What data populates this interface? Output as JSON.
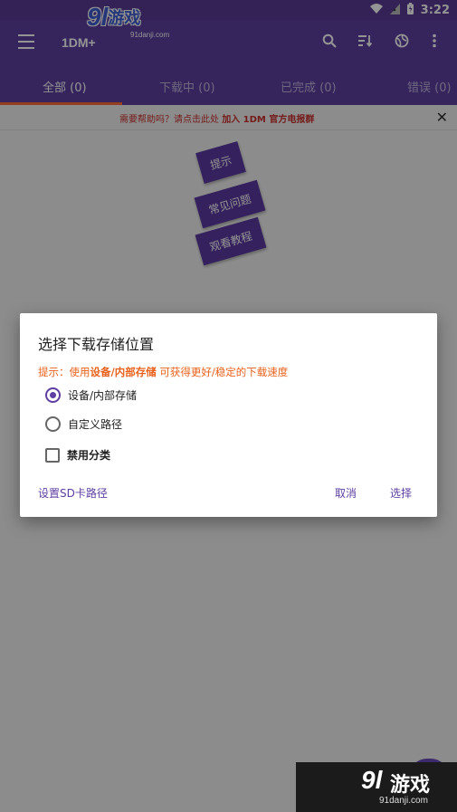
{
  "status_bar": {
    "time": "3:22",
    "icons": [
      "wifi-icon",
      "signal-icon",
      "battery-icon"
    ]
  },
  "appbar": {
    "title": "1DM+",
    "actions": [
      "search-icon",
      "sort-icon",
      "browser-icon",
      "more-vert-icon"
    ]
  },
  "logo": {
    "num": "9l",
    "text": "游戏",
    "url": "91danji.com"
  },
  "tabs": [
    {
      "label": "全部 (0)",
      "active": true
    },
    {
      "label": "下载中 (0)",
      "active": false
    },
    {
      "label": "已完成 (0)",
      "active": false
    },
    {
      "label": "错误 (0)",
      "active": false
    }
  ],
  "help_banner": {
    "prefix": "需要帮助吗？请点击此处 ",
    "link": "加入 1DM 官方电报群"
  },
  "tags": [
    "提示",
    "常见问题",
    "观看教程"
  ],
  "dialog": {
    "title": "选择下载存储位置",
    "hint_prefix": "提示：使用",
    "hint_bold": "设备/内部存储",
    "hint_suffix": " 可获得更好/稳定的下载速度",
    "options": [
      {
        "label": "设备/内部存储",
        "checked": true
      },
      {
        "label": "自定义路径",
        "checked": false
      }
    ],
    "checkbox": {
      "label": "禁用分类",
      "checked": false
    },
    "sd_button": "设置SD卡路径",
    "cancel_button": "取消",
    "select_button": "选择"
  },
  "watermark": {
    "num": "9l",
    "text": "游戏",
    "url": "91danji.com"
  },
  "colors": {
    "primary": "#5e3ea1",
    "accent": "#ff6d3a",
    "hint": "#e8611b",
    "banner_text": "#c8302e"
  }
}
